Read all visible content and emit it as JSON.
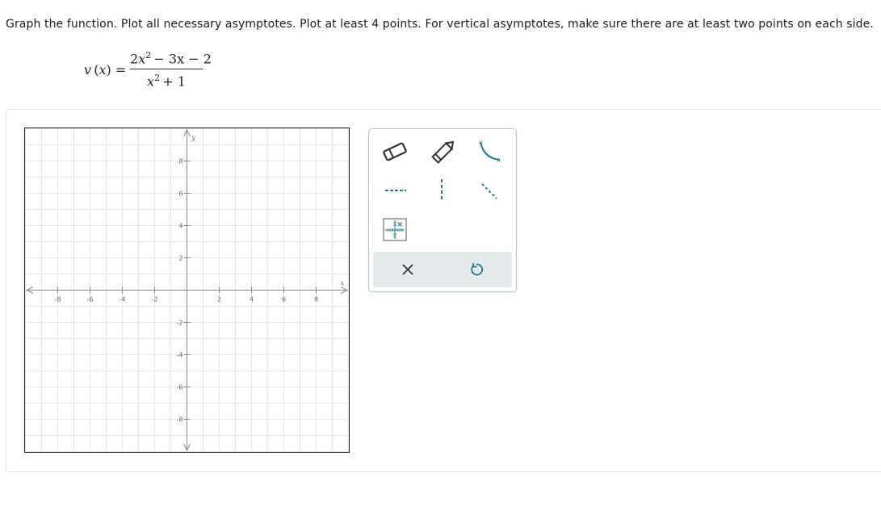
{
  "prompt": {
    "instructions": "Graph the function. Plot all necessary asymptotes. Plot at least 4 points. For vertical asymptotes, make sure there are at least two points on each side."
  },
  "equation": {
    "function_name": "v",
    "variable": "x",
    "numerator_lead_coef": "2",
    "numerator_var": "x",
    "numerator_exp": "2",
    "numerator_rest": "− 3x − 2",
    "denominator_var": "x",
    "denominator_exp": "2",
    "denominator_rest": "+ 1"
  },
  "graph": {
    "x_axis_label": "x",
    "y_axis_label": "y",
    "x_tick_labels": [
      "-8",
      "-6",
      "-4",
      "-2",
      "2",
      "4",
      "6",
      "8"
    ],
    "y_tick_labels": [
      "8",
      "6",
      "4",
      "2",
      "-2",
      "-4",
      "-6",
      "-8"
    ],
    "x_range": [
      -10,
      10
    ],
    "y_range": [
      -10,
      10
    ],
    "grid_step": 1,
    "tick_step": 2,
    "grid": true,
    "grid_color": "#e3e6e8",
    "axis_color": "#888888"
  },
  "toolbar": {
    "tools": [
      {
        "name": "eraser-tool",
        "icon": "eraser-icon"
      },
      {
        "name": "pencil-tool",
        "icon": "pencil-icon"
      },
      {
        "name": "curve-tool",
        "icon": "curve-icon"
      },
      {
        "name": "horizontal-asymptote-tool",
        "icon": "horizontal-dashed-line-icon"
      },
      {
        "name": "vertical-asymptote-tool",
        "icon": "vertical-dashed-line-icon"
      },
      {
        "name": "oblique-asymptote-tool",
        "icon": "oblique-dashed-line-icon"
      },
      {
        "name": "point-tool",
        "icon": "point-grid-icon"
      }
    ],
    "actions": [
      {
        "name": "clear-button",
        "icon": "close-icon"
      },
      {
        "name": "undo-button",
        "icon": "undo-icon"
      }
    ],
    "accent_color": "#1b7a8c"
  }
}
